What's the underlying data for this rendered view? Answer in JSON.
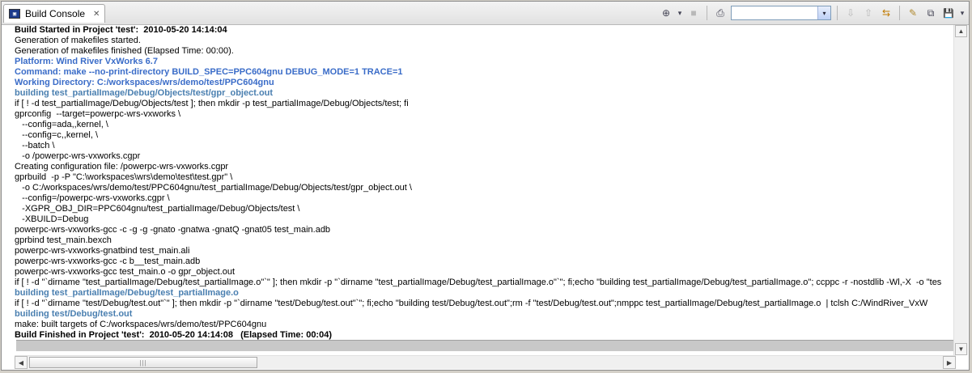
{
  "tab": {
    "title": "Build Console",
    "icon": "console-icon",
    "close": "✕"
  },
  "toolbar": {
    "buttons": [
      {
        "name": "new-console-icon",
        "glyph": "⊕"
      },
      {
        "name": "dropdown-chevron-icon",
        "glyph": "▾"
      },
      {
        "name": "stop-icon",
        "glyph": "■"
      },
      {
        "name": "print-icon",
        "glyph": "⎙"
      },
      {
        "name": "combo-arrow",
        "glyph": "▾"
      },
      {
        "name": "next-error-icon",
        "glyph": "⇩"
      },
      {
        "name": "prev-error-icon",
        "glyph": "⇧"
      },
      {
        "name": "scroll-lock-icon",
        "glyph": "⇆"
      },
      {
        "name": "clear-console-icon",
        "glyph": "✎"
      },
      {
        "name": "maximize-icon",
        "glyph": "⧉"
      },
      {
        "name": "save-icon",
        "glyph": "💾"
      },
      {
        "name": "view-menu-icon",
        "glyph": "▾"
      }
    ]
  },
  "console": {
    "lines": [
      {
        "text": "Build Started in Project 'test':  2010-05-20 14:14:04",
        "style": "bold"
      },
      {
        "text": "Generation of makefiles started.",
        "style": "normal"
      },
      {
        "text": "Generation of makefiles finished (Elapsed Time: 00:00).",
        "style": "normal"
      },
      {
        "text": "Platform: Wind River VxWorks 6.7",
        "style": "info"
      },
      {
        "text": "Command: make --no-print-directory BUILD_SPEC=PPC604gnu DEBUG_MODE=1 TRACE=1",
        "style": "info"
      },
      {
        "text": "Working Directory: C:/workspaces/wrs/demo/test/PPC604gnu",
        "style": "info"
      },
      {
        "text": "building test_partialImage/Debug/Objects/test/gpr_object.out",
        "style": "build"
      },
      {
        "text": "if [ ! -d test_partialImage/Debug/Objects/test ]; then mkdir -p test_partialImage/Debug/Objects/test; fi",
        "style": "normal"
      },
      {
        "text": "gprconfig  --target=powerpc-wrs-vxworks \\",
        "style": "normal"
      },
      {
        "text": "   --config=ada,,kernel, \\",
        "style": "normal"
      },
      {
        "text": "   --config=c,,kernel, \\",
        "style": "normal"
      },
      {
        "text": "   --batch \\",
        "style": "normal"
      },
      {
        "text": "   -o /powerpc-wrs-vxworks.cgpr",
        "style": "normal"
      },
      {
        "text": "Creating configuration file: /powerpc-wrs-vxworks.cgpr",
        "style": "normal"
      },
      {
        "text": "gprbuild  -p -P \"C:\\workspaces\\wrs\\demo\\test\\test.gpr\" \\",
        "style": "normal"
      },
      {
        "text": "   -o C:/workspaces/wrs/demo/test/PPC604gnu/test_partialImage/Debug/Objects/test/gpr_object.out \\",
        "style": "normal"
      },
      {
        "text": "   --config=/powerpc-wrs-vxworks.cgpr \\",
        "style": "normal"
      },
      {
        "text": "   -XGPR_OBJ_DIR=PPC604gnu/test_partialImage/Debug/Objects/test \\",
        "style": "normal"
      },
      {
        "text": "   -XBUILD=Debug",
        "style": "normal"
      },
      {
        "text": "powerpc-wrs-vxworks-gcc -c -g -g -gnato -gnatwa -gnatQ -gnat05 test_main.adb",
        "style": "normal"
      },
      {
        "text": "gprbind test_main.bexch",
        "style": "normal"
      },
      {
        "text": "powerpc-wrs-vxworks-gnatbind test_main.ali",
        "style": "normal"
      },
      {
        "text": "powerpc-wrs-vxworks-gcc -c b__test_main.adb",
        "style": "normal"
      },
      {
        "text": "powerpc-wrs-vxworks-gcc test_main.o -o gpr_object.out",
        "style": "normal"
      },
      {
        "text": "if [ ! -d \"`dirname \"test_partialImage/Debug/test_partialImage.o\"`\" ]; then mkdir -p \"`dirname \"test_partialImage/Debug/test_partialImage.o\"`\"; fi;echo \"building test_partialImage/Debug/test_partialImage.o\"; ccppc -r -nostdlib -Wl,-X  -o \"tes",
        "style": "normal"
      },
      {
        "text": "building test_partialImage/Debug/test_partialImage.o",
        "style": "build"
      },
      {
        "text": "if [ ! -d \"`dirname \"test/Debug/test.out\"`\" ]; then mkdir -p \"`dirname \"test/Debug/test.out\"`\"; fi;echo \"building test/Debug/test.out\";rm -f \"test/Debug/test.out\";nmppc test_partialImage/Debug/test_partialImage.o  | tclsh C:/WindRiver_VxW",
        "style": "normal"
      },
      {
        "text": "building test/Debug/test.out",
        "style": "build"
      },
      {
        "text": "make: built targets of C:/workspaces/wrs/demo/test/PPC604gnu",
        "style": "normal"
      },
      {
        "text": "Build Finished in Project 'test':  2010-05-20 14:14:08   (Elapsed Time: 00:04)",
        "style": "bold"
      }
    ]
  },
  "scrollbars": {
    "up": "▲",
    "down": "▼",
    "left": "◀",
    "right": "▶",
    "grip": "|||"
  }
}
